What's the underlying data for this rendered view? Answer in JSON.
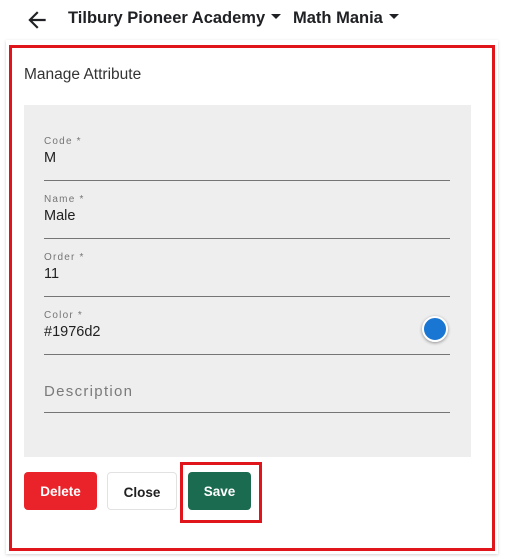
{
  "header": {
    "back_icon": "arrow-left-icon",
    "school": "Tilbury Pioneer Academy",
    "class": "Math Mania"
  },
  "form": {
    "title": "Manage Attribute",
    "fields": {
      "code": {
        "label": "Code *",
        "value": "M"
      },
      "name": {
        "label": "Name *",
        "value": "Male"
      },
      "order": {
        "label": "Order *",
        "value": "11"
      },
      "color": {
        "label": "Color *",
        "value": "#1976d2",
        "swatch": "#1976d2"
      },
      "description": {
        "placeholder": "Description",
        "value": ""
      }
    }
  },
  "actions": {
    "delete": "Delete",
    "close": "Close",
    "save": "Save"
  },
  "colors": {
    "delete": "#ea2229",
    "save": "#1a6b50",
    "highlight": "#e0141b",
    "panel": "#eeeeee"
  }
}
